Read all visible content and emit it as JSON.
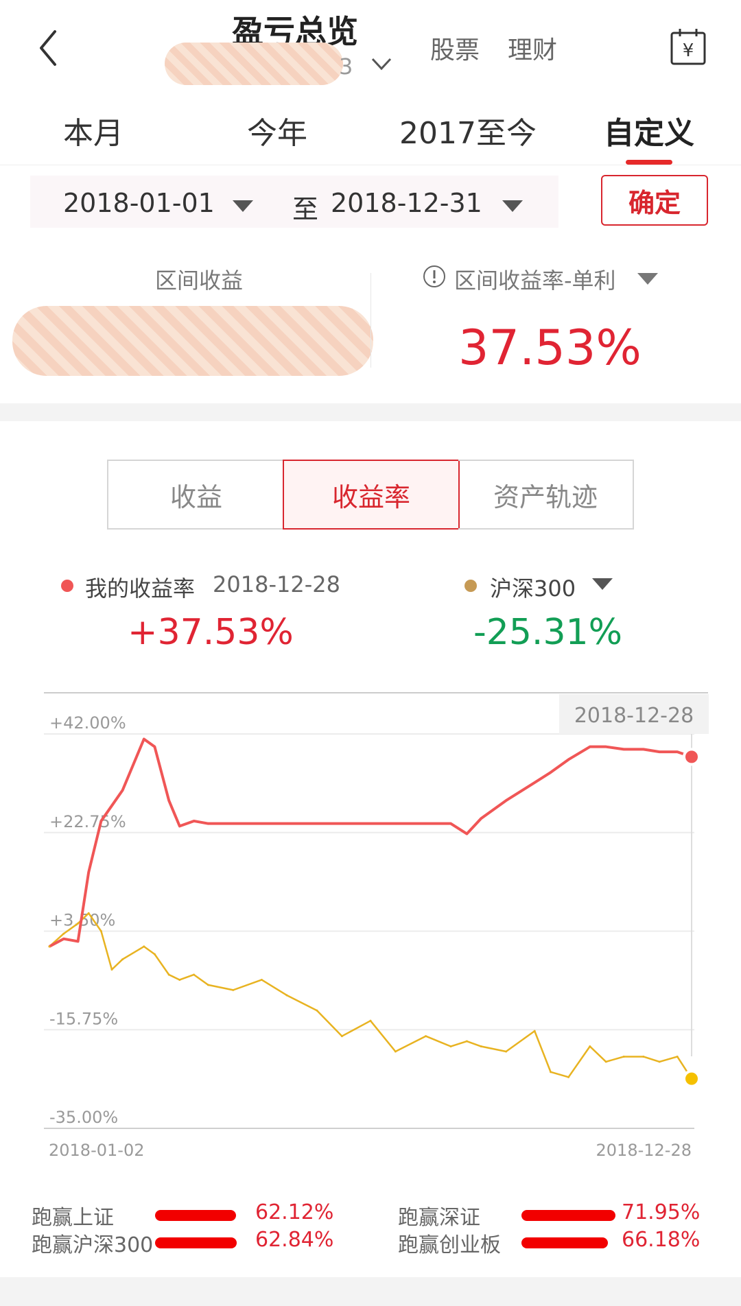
{
  "header": {
    "title": "盈亏总览",
    "account_suffix": "3",
    "nav_stock": "股票",
    "nav_wealth": "理财"
  },
  "tabs": [
    {
      "label": "本月"
    },
    {
      "label": "今年"
    },
    {
      "label": "2017至今"
    },
    {
      "label": "自定义",
      "active": true
    }
  ],
  "date_range": {
    "start": "2018-01-01",
    "to": "至",
    "end": "2018-12-31",
    "confirm": "确定"
  },
  "summary": {
    "profit_label": "区间收益",
    "rate_label": "区间收益率-单利",
    "rate_value": "37.53%"
  },
  "segments": [
    "收益",
    "收益率",
    "资产轨迹"
  ],
  "legend": {
    "mine_label": "我的收益率",
    "mine_date": "2018-12-28",
    "mine_value": "+37.53%",
    "bench_label": "沪深300",
    "bench_value": "-25.31%"
  },
  "colors": {
    "red": "#e02433",
    "green": "#129e55",
    "mine_line": "#f05656",
    "bench_line": "#e8b321"
  },
  "chart_data": {
    "type": "line",
    "tooltip_date": "2018-12-28",
    "x_start_label": "2018-01-02",
    "x_end_label": "2018-12-28",
    "y_ticks": [
      "+42.00%",
      "+22.75%",
      "+3.50%",
      "-15.75%",
      "-35.00%"
    ],
    "ylim": [
      -35,
      42
    ],
    "x": [
      "2018-01-02",
      "2018-01-10",
      "2018-01-18",
      "2018-01-24",
      "2018-01-31",
      "2018-02-06",
      "2018-02-12",
      "2018-02-24",
      "2018-03-02",
      "2018-03-10",
      "2018-03-16",
      "2018-03-24",
      "2018-04-01",
      "2018-04-15",
      "2018-05-01",
      "2018-05-15",
      "2018-06-01",
      "2018-06-15",
      "2018-07-01",
      "2018-07-15",
      "2018-08-01",
      "2018-08-15",
      "2018-08-24",
      "2018-09-01",
      "2018-09-15",
      "2018-10-01",
      "2018-10-10",
      "2018-10-20",
      "2018-11-01",
      "2018-11-10",
      "2018-11-20",
      "2018-12-01",
      "2018-12-10",
      "2018-12-20",
      "2018-12-28"
    ],
    "series": [
      {
        "name": "我的收益率",
        "values": [
          0.5,
          2,
          1.5,
          15,
          25,
          28,
          31,
          41,
          39.5,
          29,
          24,
          25,
          24.5,
          24.5,
          24.5,
          24.5,
          24.5,
          24.5,
          24.5,
          24.5,
          24.5,
          24.5,
          22.5,
          25.5,
          29,
          32.5,
          34.5,
          37,
          39.5,
          39.5,
          39,
          39,
          38.5,
          38.5,
          37.53
        ]
      },
      {
        "name": "沪深300",
        "values": [
          0.5,
          3,
          5,
          7,
          3.5,
          -4,
          -2,
          0.5,
          -1,
          -5,
          -6,
          -5,
          -7,
          -8,
          -6,
          -9,
          -12,
          -17,
          -14,
          -20,
          -17,
          -19,
          -18,
          -19,
          -20,
          -16,
          -24,
          -25,
          -19,
          -22,
          -21,
          -21,
          -22,
          -21,
          -25.31
        ]
      }
    ]
  },
  "stats": [
    {
      "label": "跑赢上证",
      "value": "62.12%",
      "ratio": 0.6212
    },
    {
      "label": "跑赢深证",
      "value": "71.95%",
      "ratio": 0.7195
    },
    {
      "label": "跑赢沪深300",
      "value": "62.84%",
      "ratio": 0.6284
    },
    {
      "label": "跑赢创业板",
      "value": "66.18%",
      "ratio": 0.6618
    }
  ]
}
